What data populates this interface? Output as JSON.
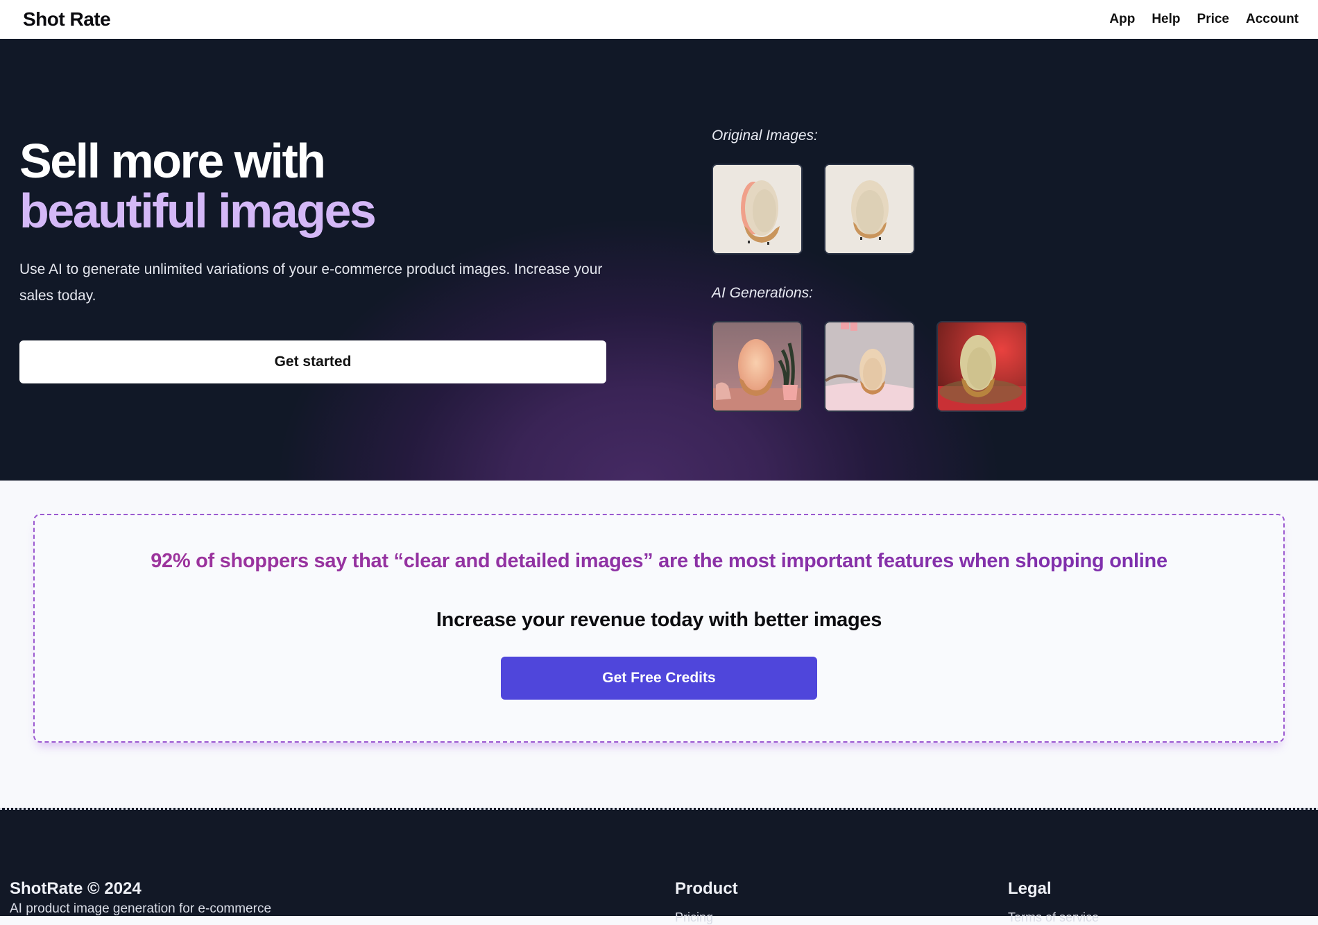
{
  "nav": {
    "brand": "Shot Rate",
    "links": [
      "App",
      "Help",
      "Price",
      "Account"
    ]
  },
  "hero": {
    "title_line1": "Sell more with",
    "title_line2": "beautiful images",
    "subtitle": "Use AI to generate unlimited variations of your e-commerce product images. Increase your sales today.",
    "cta_label": "Get started",
    "accent_color": "#d4b8f7",
    "gallery": {
      "original_label": "Original Images:",
      "original_images": [
        {
          "name": "original-image-side-view",
          "alt": "Wooden egg lamp, side view"
        },
        {
          "name": "original-image-front-view",
          "alt": "Wooden egg lamp, front view"
        }
      ],
      "ai_label": "AI Generations:",
      "ai_images": [
        {
          "name": "ai-image-desk-plant",
          "alt": "Lamp on pink desk with plant"
        },
        {
          "name": "ai-image-bedroom",
          "alt": "Lamp on bed in nursery"
        },
        {
          "name": "ai-image-red-studio",
          "alt": "Lamp in red studio light"
        }
      ]
    }
  },
  "cta": {
    "stat": "92% of shoppers say that “clear and detailed images” are the most important features when shopping online",
    "headline": "Increase your revenue today with better images",
    "button_label": "Get Free Credits",
    "button_color": "#4f46db"
  },
  "footer": {
    "brand": "ShotRate © 2024",
    "tagline": "AI product image generation for e-commerce",
    "columns": [
      {
        "title": "Product",
        "first_link": "Pricing"
      },
      {
        "title": "Legal",
        "first_link": "Terms of service"
      }
    ]
  }
}
